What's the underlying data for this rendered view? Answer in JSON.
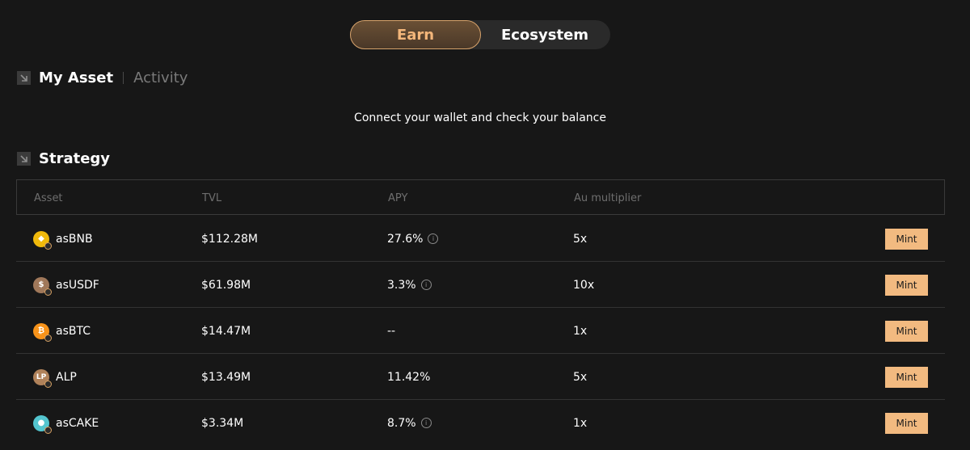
{
  "toggle": {
    "earn_label": "Earn",
    "eco_label": "Ecosystem"
  },
  "my_asset": {
    "title": "My Asset",
    "tab_activity": "Activity",
    "icon": "arrow-down-right-icon"
  },
  "connect_message": "Connect your wallet and check your balance",
  "strategy": {
    "title": "Strategy",
    "icon": "arrow-down-right-icon",
    "columns": [
      "Asset",
      "TVL",
      "APY",
      "Au multiplier"
    ],
    "rows": [
      {
        "asset": "asBNB",
        "tvl": "$112.28M",
        "apy": "27.6%",
        "apy_info": true,
        "multiplier": "5x",
        "action": "Mint",
        "icon_color": "#f0b90b",
        "icon_glyph": "◆"
      },
      {
        "asset": "asUSDF",
        "tvl": "$61.98M",
        "apy": "3.3%",
        "apy_info": true,
        "multiplier": "10x",
        "action": "Mint",
        "icon_color": "#a0785a",
        "icon_glyph": "$"
      },
      {
        "asset": "asBTC",
        "tvl": "$14.47M",
        "apy": "--",
        "apy_info": false,
        "multiplier": "1x",
        "action": "Mint",
        "icon_color": "#f7931a",
        "icon_glyph": "₿"
      },
      {
        "asset": "ALP",
        "tvl": "$13.49M",
        "apy": "11.42%",
        "apy_info": false,
        "multiplier": "5x",
        "action": "Mint",
        "icon_color": "#b0825a",
        "icon_glyph": "LP"
      },
      {
        "asset": "asCAKE",
        "tvl": "$3.34M",
        "apy": "8.7%",
        "apy_info": true,
        "multiplier": "1x",
        "action": "Mint",
        "icon_color": "#53c5cf",
        "icon_glyph": "●"
      }
    ]
  },
  "colors": {
    "accent": "#f2ba80",
    "background": "#171717",
    "border": "#3a3a3a"
  }
}
